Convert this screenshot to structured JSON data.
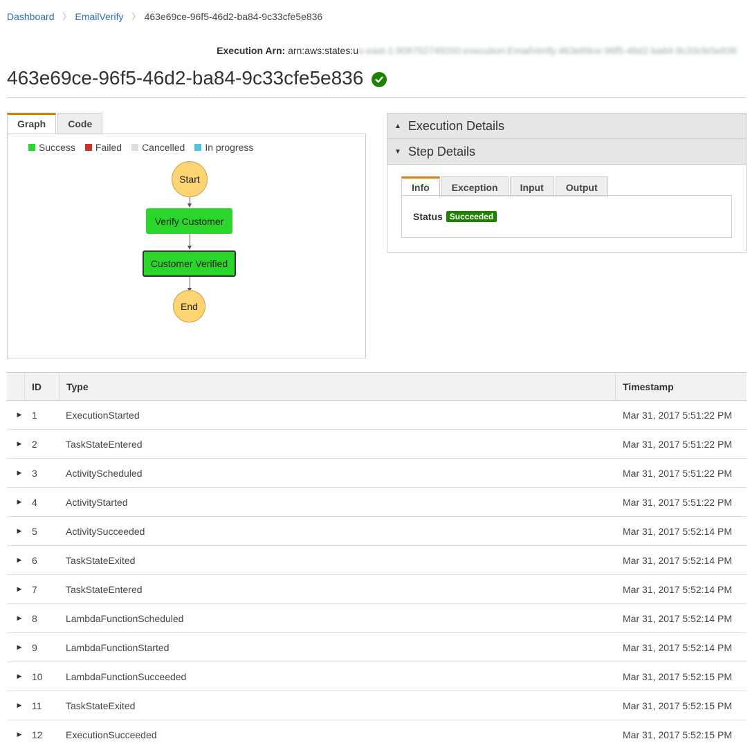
{
  "breadcrumb": {
    "items": [
      "Dashboard",
      "EmailVerify"
    ],
    "current": "463e69ce-96f5-46d2-ba84-9c33cfe5e836"
  },
  "execution_arn": {
    "label": "Execution Arn:",
    "value_visible": "arn:aws:states:u",
    "value_blurred": "s-east-1:908752749200:execution:EmailVerify:463e69ce-96f5-46d2-ba84-9c33cfe5e836"
  },
  "title": "463e69ce-96f5-46d2-ba84-9c33cfe5e836",
  "graph_tabs": [
    "Graph",
    "Code"
  ],
  "legend": [
    {
      "label": "Success",
      "color": "#2bd62b"
    },
    {
      "label": "Failed",
      "color": "#d12e2e"
    },
    {
      "label": "Cancelled",
      "color": "#dddddd"
    },
    {
      "label": "In progress",
      "color": "#4fc3e0"
    }
  ],
  "graph": {
    "start": "Start",
    "verify": "Verify Customer",
    "verified": "Customer Verified",
    "end": "End"
  },
  "panel": {
    "execution_details": "Execution Details",
    "step_details": "Step Details",
    "tabs": [
      "Info",
      "Exception",
      "Input",
      "Output"
    ],
    "status_label": "Status",
    "status_value": "Succeeded"
  },
  "table": {
    "headers": [
      "ID",
      "Type",
      "Timestamp"
    ],
    "rows": [
      {
        "id": "1",
        "type": "ExecutionStarted",
        "ts": "Mar 31, 2017 5:51:22 PM"
      },
      {
        "id": "2",
        "type": "TaskStateEntered",
        "ts": "Mar 31, 2017 5:51:22 PM"
      },
      {
        "id": "3",
        "type": "ActivityScheduled",
        "ts": "Mar 31, 2017 5:51:22 PM"
      },
      {
        "id": "4",
        "type": "ActivityStarted",
        "ts": "Mar 31, 2017 5:51:22 PM"
      },
      {
        "id": "5",
        "type": "ActivitySucceeded",
        "ts": "Mar 31, 2017 5:52:14 PM"
      },
      {
        "id": "6",
        "type": "TaskStateExited",
        "ts": "Mar 31, 2017 5:52:14 PM"
      },
      {
        "id": "7",
        "type": "TaskStateEntered",
        "ts": "Mar 31, 2017 5:52:14 PM"
      },
      {
        "id": "8",
        "type": "LambdaFunctionScheduled",
        "ts": "Mar 31, 2017 5:52:14 PM"
      },
      {
        "id": "9",
        "type": "LambdaFunctionStarted",
        "ts": "Mar 31, 2017 5:52:14 PM"
      },
      {
        "id": "10",
        "type": "LambdaFunctionSucceeded",
        "ts": "Mar 31, 2017 5:52:15 PM"
      },
      {
        "id": "11",
        "type": "TaskStateExited",
        "ts": "Mar 31, 2017 5:52:15 PM"
      },
      {
        "id": "12",
        "type": "ExecutionSucceeded",
        "ts": "Mar 31, 2017 5:52:15 PM"
      }
    ]
  }
}
